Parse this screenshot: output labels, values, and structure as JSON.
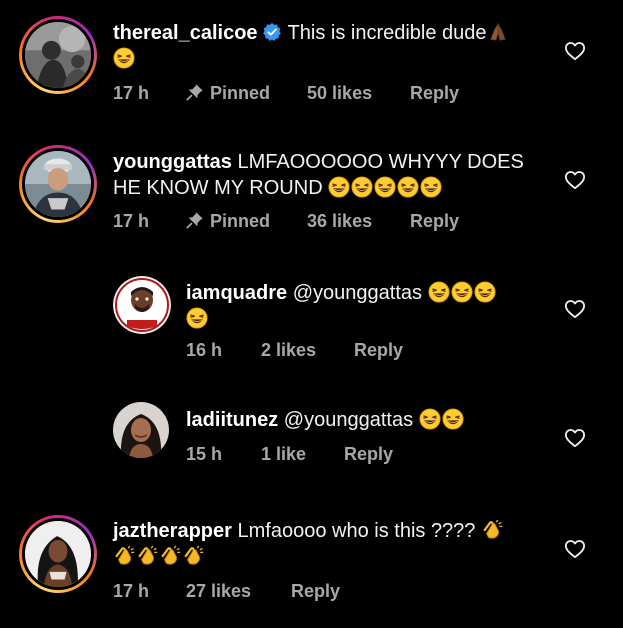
{
  "comments": [
    {
      "username": "thereal_calicoe",
      "verified": true,
      "text": "This is incredible dude",
      "emojis": [
        "folded-hands-emoji",
        "grinning-squinting-emoji"
      ],
      "time": "17 h",
      "pinned_label": "Pinned",
      "likes": "50 likes",
      "reply": "Reply"
    },
    {
      "username": "younggattas",
      "text_line1": "LMFAOOOOOO WHYYY DOES",
      "text_line2": "HE KNOW MY ROUND",
      "emojis": [
        "grinning-squinting-emoji",
        "grinning-squinting-emoji",
        "grinning-squinting-emoji",
        "grinning-squinting-emoji",
        "grinning-squinting-emoji"
      ],
      "time": "17 h",
      "pinned_label": "Pinned",
      "likes": "36 likes",
      "reply": "Reply"
    },
    {
      "username": "iamquadre",
      "text": "@younggattas",
      "emojis": [
        "grinning-squinting-emoji",
        "grinning-squinting-emoji",
        "grinning-squinting-emoji",
        "grinning-squinting-emoji"
      ],
      "time": "16 h",
      "likes": "2 likes",
      "reply": "Reply"
    },
    {
      "username": "ladiitunez",
      "text": "@younggattas",
      "emojis": [
        "grinning-squinting-emoji",
        "grinning-squinting-emoji"
      ],
      "time": "15 h",
      "likes": "1 like",
      "reply": "Reply"
    },
    {
      "username": "jaztherapper",
      "text": "Lmfaoooo who is this ????",
      "emojis": [
        "clapping-hands-emoji",
        "clapping-hands-emoji",
        "clapping-hands-emoji",
        "clapping-hands-emoji",
        "clapping-hands-emoji"
      ],
      "time": "17 h",
      "likes": "27 likes",
      "reply": "Reply"
    }
  ],
  "colors": {
    "background": "#000000",
    "text": "#f2f2f2",
    "meta": "#a8a8a8",
    "verified": "#3897f0"
  },
  "icons": {
    "like": "heart-outline-icon",
    "pin": "pushpin-icon",
    "verified": "verified-badge-icon"
  }
}
